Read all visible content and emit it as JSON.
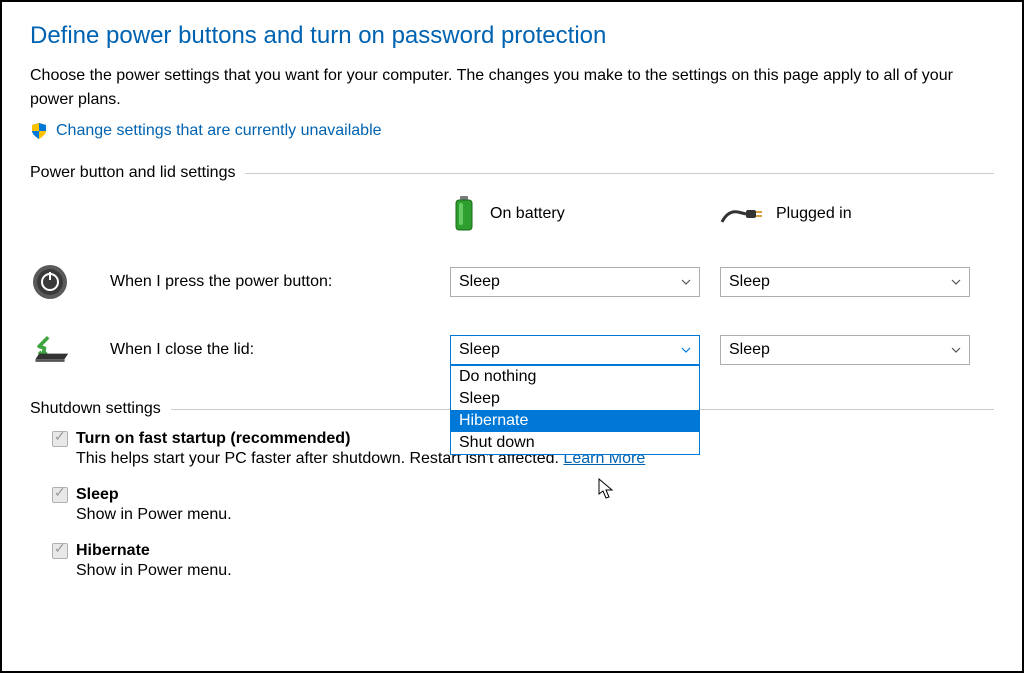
{
  "title": "Define power buttons and turn on password protection",
  "intro": "Choose the power settings that you want for your computer. The changes you make to the settings on this page apply to all of your power plans.",
  "admin_link": "Change settings that are currently unavailable",
  "sections": {
    "power_lid": "Power button and lid settings",
    "shutdown": "Shutdown settings"
  },
  "columns": {
    "battery": "On battery",
    "plugged": "Plugged in"
  },
  "rows": {
    "power_button": {
      "label": "When I press the power button:",
      "battery_value": "Sleep",
      "plugged_value": "Sleep"
    },
    "close_lid": {
      "label": "When I close the lid:",
      "battery_value": "Sleep",
      "plugged_value": "Sleep"
    }
  },
  "dropdown_options": {
    "opt0": "Do nothing",
    "opt1": "Sleep",
    "opt2": "Hibernate",
    "opt3": "Shut down"
  },
  "shutdown_items": {
    "fast_startup": {
      "label": "Turn on fast startup (recommended)",
      "desc_a": "This helps start your PC faster after shutdown. Restart isn't affected. ",
      "learn_more": "Learn More"
    },
    "sleep": {
      "label": "Sleep",
      "desc": "Show in Power menu."
    },
    "hibernate": {
      "label": "Hibernate",
      "desc": "Show in Power menu."
    }
  }
}
